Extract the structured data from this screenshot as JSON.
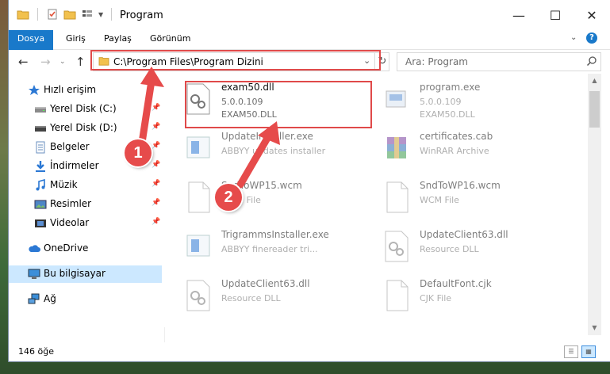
{
  "window": {
    "title": "Program",
    "minimize_glyph": "—",
    "maximize_glyph": "☐",
    "close_glyph": "✕"
  },
  "ribbon": {
    "tabs": [
      "Dosya",
      "Giriş",
      "Paylaş",
      "Görünüm"
    ],
    "accent": "#1979ca"
  },
  "address": {
    "path": "C:\\Program Files\\Program Dizini",
    "search_placeholder": "Ara: Program"
  },
  "sidebar": {
    "items": [
      {
        "label": "Hızlı erişim",
        "icon": "star-icon",
        "pinned": false
      },
      {
        "label": "Yerel Disk (C:)",
        "icon": "drive-icon",
        "pinned": true
      },
      {
        "label": "Yerel Disk (D:)",
        "icon": "drive-icon",
        "pinned": true
      },
      {
        "label": "Belgeler",
        "icon": "documents-icon",
        "pinned": true
      },
      {
        "label": "İndirmeler",
        "icon": "download-icon",
        "pinned": true
      },
      {
        "label": "Müzik",
        "icon": "music-icon",
        "pinned": true
      },
      {
        "label": "Resimler",
        "icon": "pictures-icon",
        "pinned": true
      },
      {
        "label": "Videolar",
        "icon": "videos-icon",
        "pinned": true
      },
      {
        "label": "OneDrive",
        "icon": "cloud-icon",
        "pinned": false
      },
      {
        "label": "Bu bilgisayar",
        "icon": "computer-icon",
        "pinned": false,
        "selected": true
      },
      {
        "label": "Ağ",
        "icon": "network-icon",
        "pinned": false
      }
    ]
  },
  "files": [
    {
      "name": "exam50.dll",
      "line2": "5.0.0.109",
      "line3": "EXAM50.DLL",
      "icon": "dll-gear-icon",
      "highlighted": true
    },
    {
      "name": "program.exe",
      "line2": "5.0.0.109",
      "line3": "EXAM50.DLL",
      "icon": "exe-icon"
    },
    {
      "name": "UpdateInstaller.exe",
      "line2": "ABBYY updates installer",
      "line3": "",
      "icon": "installer-icon"
    },
    {
      "name": "certificates.cab",
      "line2": "WinRAR Archive",
      "line3": "",
      "icon": "winrar-icon"
    },
    {
      "name": "SndToWP15.wcm",
      "line2": "WCM File",
      "line3": "",
      "icon": "blank-file-icon"
    },
    {
      "name": "SndToWP16.wcm",
      "line2": "WCM File",
      "line3": "",
      "icon": "blank-file-icon"
    },
    {
      "name": "TrigrammsInstaller.exe",
      "line2": "ABBYY finereader tri...",
      "line3": "",
      "icon": "installer-icon"
    },
    {
      "name": "UpdateClient63.dll",
      "line2": "Resource DLL",
      "line3": "",
      "icon": "dll-gear-icon"
    },
    {
      "name": "UpdateClient63.dll",
      "line2": "Resource DLL",
      "line3": "",
      "icon": "dll-gear-icon"
    },
    {
      "name": "DefaultFont.cjk",
      "line2": "CJK File",
      "line3": "",
      "icon": "blank-file-icon"
    }
  ],
  "status": {
    "count": "146 öğe"
  },
  "annotations": {
    "badge1": "1",
    "badge2": "2",
    "color": "#e64b4b"
  }
}
